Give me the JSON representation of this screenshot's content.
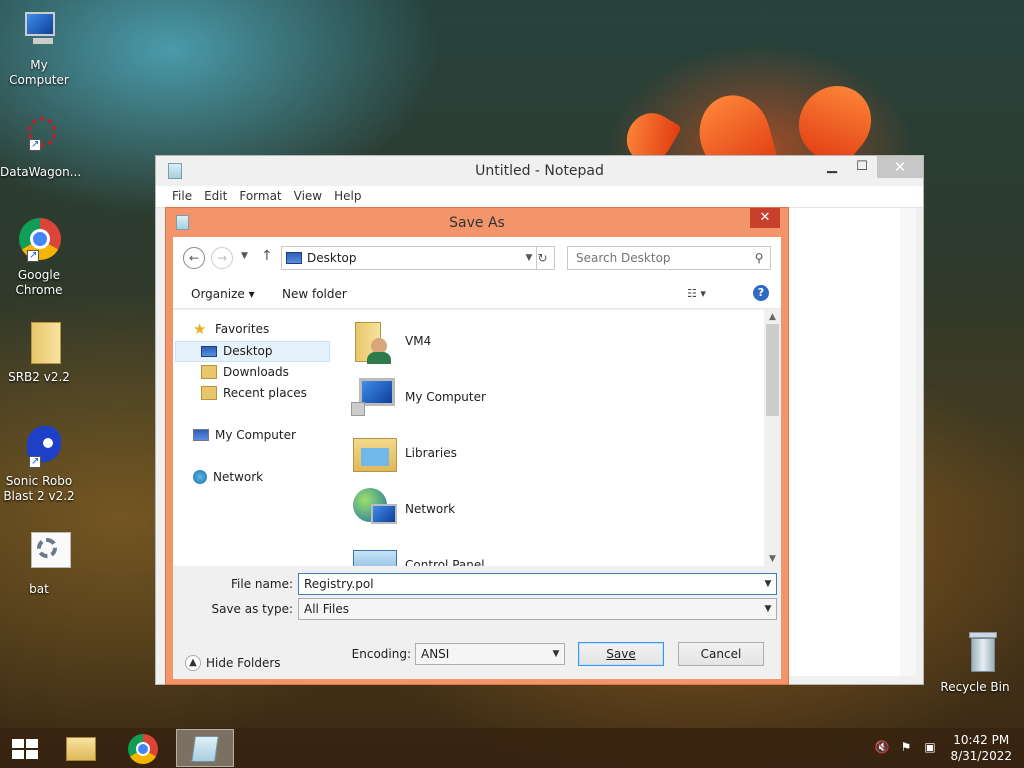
{
  "desktop": {
    "icons": [
      {
        "label": "My Computer"
      },
      {
        "label": "DataWagon..."
      },
      {
        "label": "Google Chrome"
      },
      {
        "label": "SRB2 v2.2"
      },
      {
        "label": "Sonic Robo Blast 2 v2.2"
      },
      {
        "label": "bat"
      },
      {
        "label": "Recycle Bin"
      }
    ]
  },
  "notepad": {
    "title": "Untitled - Notepad",
    "controls": {
      "minimize": "▁",
      "maximize": "☐",
      "close": "✕"
    },
    "menu": [
      "File",
      "Edit",
      "Format",
      "View",
      "Help"
    ]
  },
  "dialog": {
    "title": "Save As",
    "close": "✕",
    "address": "Desktop",
    "search_placeholder": "Search Desktop",
    "toolbar": {
      "organize": "Organize ▾",
      "new_folder": "New folder"
    },
    "nav": {
      "favorites": "Favorites",
      "desktop": "Desktop",
      "downloads": "Downloads",
      "recent": "Recent places",
      "mycomputer": "My Computer",
      "network": "Network"
    },
    "files": [
      "VM4",
      "My Computer",
      "Libraries",
      "Network",
      "Control Panel"
    ],
    "filename_label": "File name:",
    "filename_value": "Registry.pol",
    "type_label": "Save as type:",
    "type_value": "All Files",
    "hide_folders": "Hide Folders",
    "encoding_label": "Encoding:",
    "encoding_value": "ANSI",
    "save": "Save",
    "cancel": "Cancel"
  },
  "tray": {
    "time": "10:42 PM",
    "date": "8/31/2022"
  }
}
